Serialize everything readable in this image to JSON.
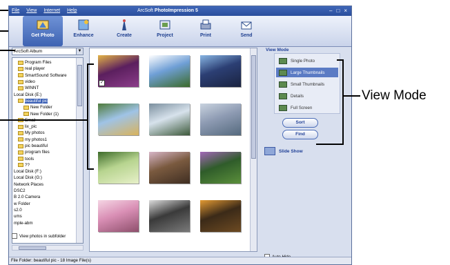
{
  "window": {
    "menu": [
      "File",
      "View",
      "Internet",
      "Help"
    ],
    "title_brand": "ArcSoft",
    "title_app": "PhotoImpression 5",
    "controls": [
      "–",
      "□",
      "×"
    ]
  },
  "toolbar": [
    {
      "label": "Get Photo",
      "active": true,
      "icon": "get-photo-icon"
    },
    {
      "label": "Enhance",
      "active": false,
      "icon": "enhance-icon"
    },
    {
      "label": "Create",
      "active": false,
      "icon": "create-icon"
    },
    {
      "label": "Project",
      "active": false,
      "icon": "project-icon"
    },
    {
      "label": "Print",
      "active": false,
      "icon": "print-icon"
    },
    {
      "label": "Send",
      "active": false,
      "icon": "send-icon"
    }
  ],
  "source_select": {
    "value": "ArcSoft Album"
  },
  "tree": [
    {
      "label": "Program Files",
      "folder": true
    },
    {
      "label": "real player",
      "folder": true
    },
    {
      "label": "SmartSound Software",
      "folder": true
    },
    {
      "label": "video",
      "folder": true
    },
    {
      "label": "WINNT",
      "folder": true
    },
    {
      "label": "Local Disk (E:)",
      "folder": false
    },
    {
      "label": "beautiful pic",
      "folder": true,
      "selected": true
    },
    {
      "label": "New Folder",
      "folder": true,
      "indent": true
    },
    {
      "label": "New Folder (1)",
      "folder": true,
      "indent": true
    },
    {
      "label": "Email",
      "folder": true
    },
    {
      "label": "lix_pic",
      "folder": true
    },
    {
      "label": "My photos",
      "folder": true
    },
    {
      "label": "my photos1",
      "folder": true
    },
    {
      "label": "pic beautiful",
      "folder": true
    },
    {
      "label": "program files",
      "folder": true
    },
    {
      "label": "tools",
      "folder": true
    },
    {
      "label": "??",
      "folder": true
    },
    {
      "label": "Local Disk (F:)",
      "folder": false
    },
    {
      "label": "Local Disk (G:)",
      "folder": false
    },
    {
      "label": "Network Places",
      "folder": false
    },
    {
      "label": "DSC2",
      "folder": false
    },
    {
      "label": "B 2.0 Camera",
      "folder": false
    },
    {
      "label": "w Folder",
      "folder": false
    },
    {
      "label": "s2.0",
      "folder": false
    },
    {
      "label": "ums",
      "folder": false
    },
    {
      "label": "mple-abm",
      "folder": false
    }
  ],
  "subfolder_checkbox": {
    "label": "View photos in subfolder",
    "checked": false
  },
  "photos": [
    {
      "colors": [
        "#5b1f5e",
        "#e3b346",
        "#8c3d8a"
      ],
      "checked": true
    },
    {
      "colors": [
        "#6f9fd6",
        "#ffffff",
        "#3c6b2a"
      ]
    },
    {
      "colors": [
        "#2c3f74",
        "#88b5e3",
        "#1a2340"
      ]
    },
    {
      "colors": [
        "#9fc3e6",
        "#4f7b3b",
        "#d9b35c"
      ]
    },
    {
      "colors": [
        "#d7e2ec",
        "#7b8f9e",
        "#3d5a3b"
      ]
    },
    {
      "colors": [
        "#8e9bb3",
        "#c9d3df",
        "#556a7e"
      ]
    },
    {
      "colors": [
        "#b7d48f",
        "#3d6b2a",
        "#e7f0c9"
      ]
    },
    {
      "colors": [
        "#7a5a3f",
        "#d7b6c7",
        "#3f2e22"
      ]
    },
    {
      "colors": [
        "#2f5c2a",
        "#a368b8",
        "#5b8f3b"
      ]
    },
    {
      "colors": [
        "#d98fb5",
        "#f5d6e4",
        "#8e4f6c"
      ]
    },
    {
      "colors": [
        "#3a3a3a",
        "#dcdcdc",
        "#7a7a7a"
      ]
    },
    {
      "colors": [
        "#3b2a18",
        "#e39a33",
        "#6d4a22"
      ]
    }
  ],
  "view_mode": {
    "title": "View Mode",
    "options": [
      {
        "label": "Single Photo",
        "selected": false
      },
      {
        "label": "Large Thumbnails",
        "selected": true
      },
      {
        "label": "Small Thumbnails",
        "selected": false
      },
      {
        "label": "Details",
        "selected": false
      },
      {
        "label": "Full Screen",
        "selected": false
      }
    ],
    "sort_label": "Sort",
    "find_label": "Find",
    "slideshow_label": "Slide Show",
    "autohide_label": "Auto Hide"
  },
  "status": "File Folder: beautiful pic - 18 Image File(s)",
  "annotation": {
    "label": "View Mode"
  }
}
